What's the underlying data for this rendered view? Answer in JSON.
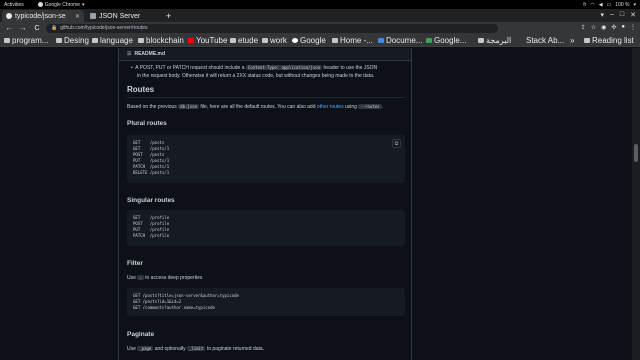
{
  "os": {
    "activities": "Activities",
    "app_name": "Google Chrome",
    "clock": "",
    "lang": "fr",
    "battery": "100 %"
  },
  "browser": {
    "tabs": [
      {
        "label": "typicode/json-se"
      },
      {
        "label": "JSON Server"
      }
    ],
    "new_tab": "+",
    "back": "←",
    "forward": "→",
    "reload": "C",
    "url": "github.com/typicode/json-server#routes",
    "bookmarks": [
      {
        "label": "program..."
      },
      {
        "label": "Desing"
      },
      {
        "label": "language"
      },
      {
        "label": "blockchain"
      },
      {
        "label": "YouTube"
      },
      {
        "label": "etude"
      },
      {
        "label": "work"
      },
      {
        "label": "Google"
      },
      {
        "label": "Home -..."
      },
      {
        "label": "Docume..."
      },
      {
        "label": "Google..."
      },
      {
        "label": "البرمجة"
      },
      {
        "label": "Stack Ab..."
      },
      {
        "label": "»"
      },
      {
        "label": "Reading list"
      }
    ]
  },
  "readme": {
    "file_name": "README.md",
    "bullet": {
      "pre": "A POST, PUT or PATCH request should include a",
      "code": "Content-Type: application/json",
      "post": "header to use the JSON",
      "line2": "in the request body. Otherwise it will return a 2XX status code, but without changes being made to the data."
    },
    "routes_title": "Routes",
    "routes_intro": {
      "pre": "Based on the previous",
      "code": "db.json",
      "mid": "file, here are all the default routes. You can also add",
      "link": "other routes",
      "mid2": "using",
      "code2": "--routes",
      "post": "."
    },
    "plural_title": "Plural routes",
    "plural_lines": [
      "GET    /posts",
      "GET    /posts/1",
      "POST   /posts",
      "PUT    /posts/1",
      "PATCH  /posts/1",
      "DELETE /posts/1"
    ],
    "singular_title": "Singular routes",
    "singular_lines": [
      "GET    /profile",
      "POST   /profile",
      "PUT    /profile",
      "PATCH  /profile"
    ],
    "filter_title": "Filter",
    "filter_text": {
      "pre": "Use",
      "code": ".",
      "post": "to access deep properties"
    },
    "filter_lines": [
      "GET /posts?title=json-server&author=typicode",
      "GET /posts?id=1&id=2",
      "GET /comments?author.name=typicode"
    ],
    "paginate_title": "Paginate",
    "paginate_text": {
      "pre": "Use",
      "code": "_page",
      "mid": "and optionally",
      "code2": "_limit",
      "post": "to paginate returned data."
    }
  }
}
